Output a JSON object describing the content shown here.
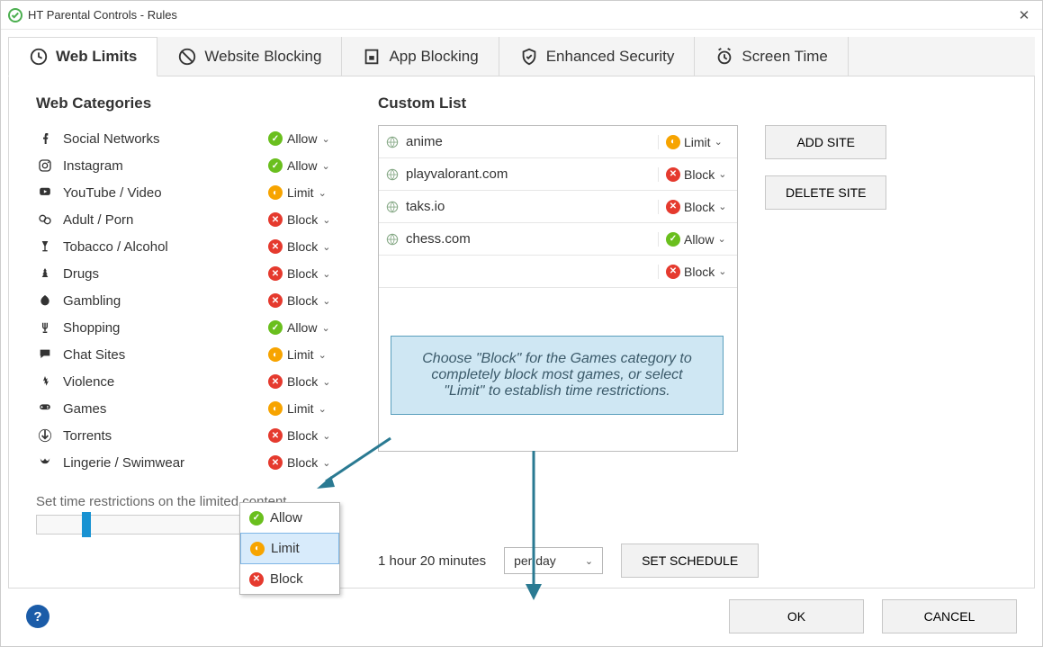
{
  "window": {
    "title": "HT Parental Controls - Rules"
  },
  "tabs": [
    {
      "label": "Web Limits"
    },
    {
      "label": "Website Blocking"
    },
    {
      "label": "App Blocking"
    },
    {
      "label": "Enhanced Security"
    },
    {
      "label": "Screen Time"
    }
  ],
  "headings": {
    "web_categories": "Web Categories",
    "custom_list": "Custom List"
  },
  "categories": [
    {
      "label": "Social Networks",
      "action": "Allow",
      "icon": "social"
    },
    {
      "label": "Instagram",
      "action": "Allow",
      "icon": "instagram"
    },
    {
      "label": "YouTube / Video",
      "action": "Limit",
      "icon": "youtube"
    },
    {
      "label": "Adult / Porn",
      "action": "Block",
      "icon": "adult"
    },
    {
      "label": "Tobacco / Alcohol",
      "action": "Block",
      "icon": "alcohol"
    },
    {
      "label": "Drugs",
      "action": "Block",
      "icon": "drugs"
    },
    {
      "label": "Gambling",
      "action": "Block",
      "icon": "gambling"
    },
    {
      "label": "Shopping",
      "action": "Allow",
      "icon": "shopping"
    },
    {
      "label": "Chat Sites",
      "action": "Limit",
      "icon": "chat"
    },
    {
      "label": "Violence",
      "action": "Block",
      "icon": "violence"
    },
    {
      "label": "Games",
      "action": "Limit",
      "icon": "games"
    },
    {
      "label": "Torrents",
      "action": "Block",
      "icon": "torrents"
    },
    {
      "label": "Lingerie / Swimwear",
      "action": "Block",
      "icon": "lingerie"
    }
  ],
  "custom_sites": [
    {
      "site": "anime",
      "action": "Limit"
    },
    {
      "site": "playvalorant.com",
      "action": "Block"
    },
    {
      "site": "taks.io",
      "action": "Block"
    },
    {
      "site": "chess.com",
      "action": "Allow"
    },
    {
      "site": "",
      "action": "Block",
      "truncated_hidden_label": true
    }
  ],
  "dropdown_options": {
    "allow": "Allow",
    "limit": "Limit",
    "block": "Block"
  },
  "side_buttons": {
    "add": "ADD SITE",
    "delete": "DELETE SITE"
  },
  "callout_text": "Choose \"Block\" for the Games category to completely block most games, or select \"Limit\" to establish time restrictions.",
  "time": {
    "label": "Set time restrictions on the limited content",
    "duration": "1 hour 20 minutes",
    "period": "per day",
    "schedule_btn": "SET SCHEDULE"
  },
  "bottom": {
    "ok": "OK",
    "cancel": "CANCEL"
  }
}
